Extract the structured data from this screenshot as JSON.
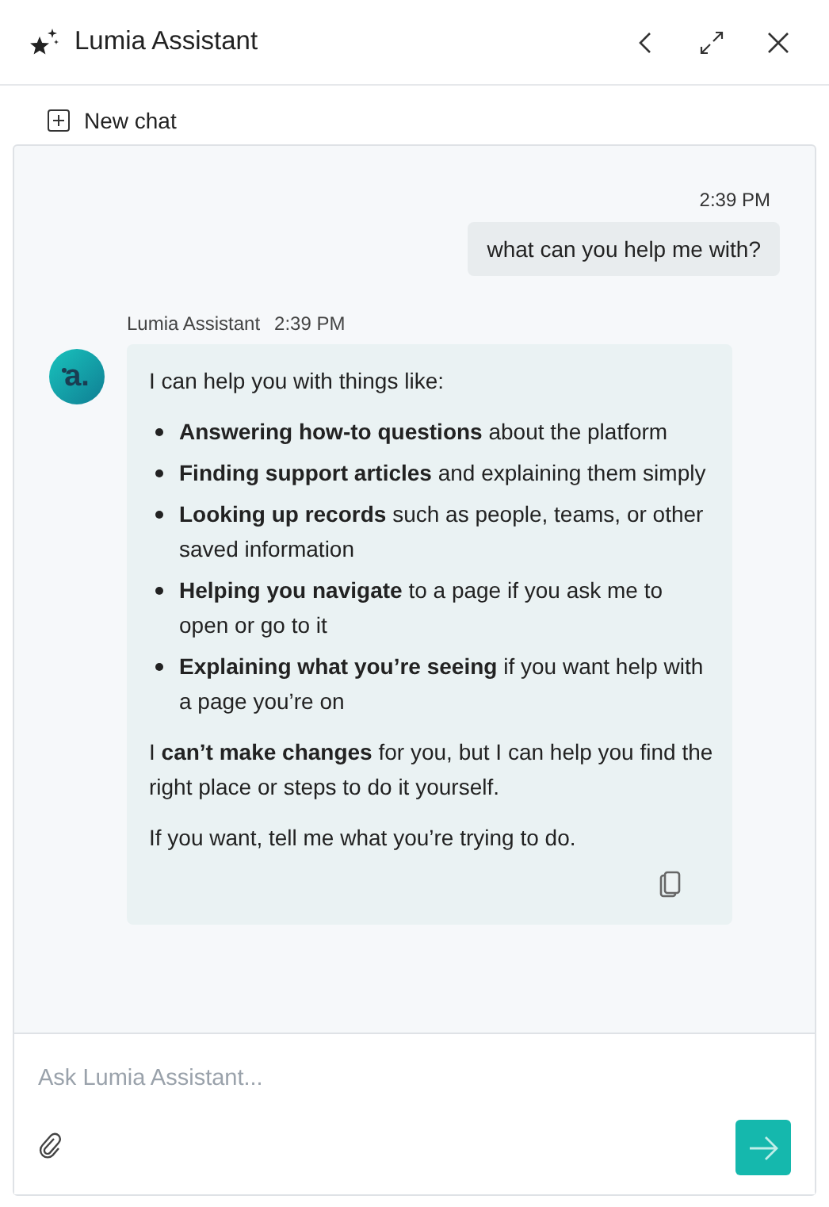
{
  "header": {
    "title": "Lumia Assistant"
  },
  "new_chat": {
    "label": "New chat"
  },
  "messages": [
    {
      "kind": "user",
      "time": "2:39 PM",
      "text": "what can you help me with?"
    },
    {
      "kind": "assistant",
      "sender": "Lumia Assistant",
      "time": "2:39 PM",
      "avatar_label": "a.",
      "intro": "I can help you with things like:",
      "bullets": [
        "**Answering how-to questions** about the platform",
        "**Finding support articles** and explaining them simply",
        "**Looking up records** such as people, teams, or other saved information",
        "**Helping you navigate** to a page if you ask me to open or go to it",
        "**Explaining what you’re seeing** if you want help with a page you’re on"
      ],
      "paragraphs": [
        "I **can’t make changes** for you, but I can help you find the right place or steps to do it yourself.",
        "If you want, tell me what you’re trying to do."
      ]
    }
  ],
  "composer": {
    "placeholder": "Ask Lumia Assistant..."
  }
}
